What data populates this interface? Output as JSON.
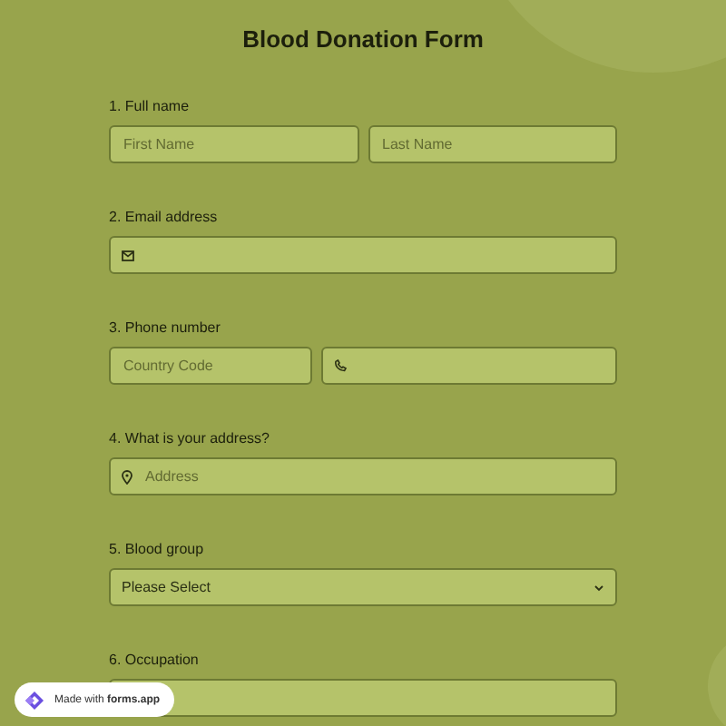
{
  "title": "Blood Donation Form",
  "questions": [
    {
      "label": "1.  Full name",
      "kind": "pair",
      "fields": [
        {
          "kind": "text",
          "placeholder": "First Name"
        },
        {
          "kind": "text",
          "placeholder": "Last Name"
        }
      ]
    },
    {
      "label": "2. Email address",
      "kind": "single",
      "fields": [
        {
          "kind": "email"
        }
      ]
    },
    {
      "label": "3. Phone number",
      "kind": "phone",
      "fields": [
        {
          "kind": "text",
          "placeholder": "Country Code"
        },
        {
          "kind": "phone"
        }
      ]
    },
    {
      "label": "4. What is your address?",
      "kind": "single",
      "fields": [
        {
          "kind": "address",
          "placeholder": "Address"
        }
      ]
    },
    {
      "label": "5. Blood group",
      "kind": "select",
      "value": "Please Select"
    },
    {
      "label": "6. Occupation",
      "kind": "single",
      "fields": [
        {
          "kind": "text"
        }
      ]
    }
  ],
  "badge": "Made with **forms.app**"
}
